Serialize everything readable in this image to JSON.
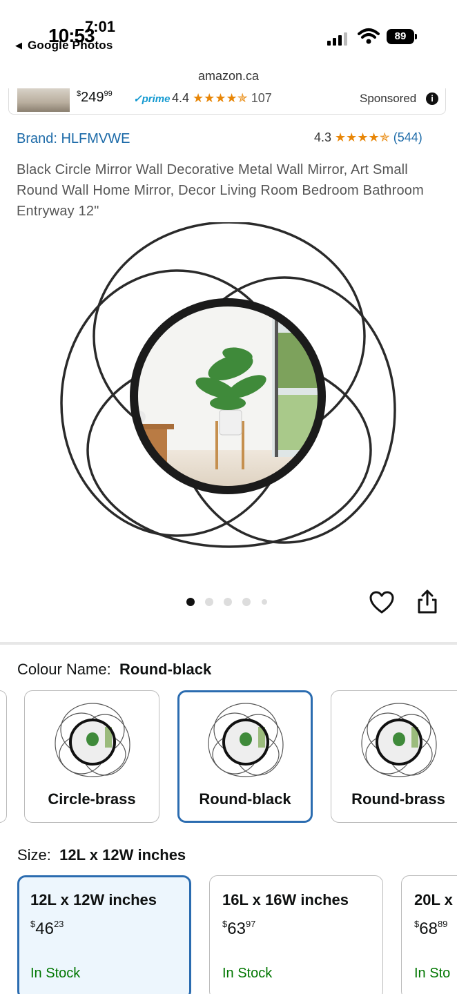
{
  "status_bar": {
    "back_app": "Google Photos",
    "clock_top": "7:01",
    "clock_overlay": "10:53",
    "battery": "89"
  },
  "url": "amazon.ca",
  "sponsored": {
    "price_whole": "249",
    "price_frac": "99",
    "price_currency": "$",
    "prime": "prime",
    "rating": "4.4",
    "stars": "★★★★✯",
    "count": "107",
    "label": "Sponsored",
    "info": "i"
  },
  "product": {
    "brand": "Brand: HLFMVWE",
    "rating": "4.3",
    "stars": "★★★★✯",
    "count": "(544)",
    "title": "Black Circle Mirror Wall Decorative Metal Wall Mirror, Art Small Round Wall Home Mirror, Decor Living Room Bedroom Bathroom Entryway 12\""
  },
  "image_carousel": {
    "total": 5,
    "active_index": 0
  },
  "colour": {
    "label": "Colour Name:",
    "selected": "Round-black",
    "options": [
      "Circle-brass",
      "Round-black",
      "Round-brass"
    ]
  },
  "size": {
    "label": "Size:",
    "selected": "12L x 12W inches",
    "options": [
      {
        "name": "12L x 12W inches",
        "currency": "$",
        "whole": "46",
        "frac": "23",
        "stock": "In Stock"
      },
      {
        "name": "16L x 16W inches",
        "currency": "$",
        "whole": "63",
        "frac": "97",
        "stock": "In Stock"
      },
      {
        "name": "20L x",
        "currency": "$",
        "whole": "68",
        "frac": "89",
        "stock": "In Sto"
      }
    ]
  },
  "colors": {
    "link": "#1c6aa8",
    "star": "#e88607",
    "in_stock": "#007600",
    "selected_border": "#2b6cb0"
  }
}
